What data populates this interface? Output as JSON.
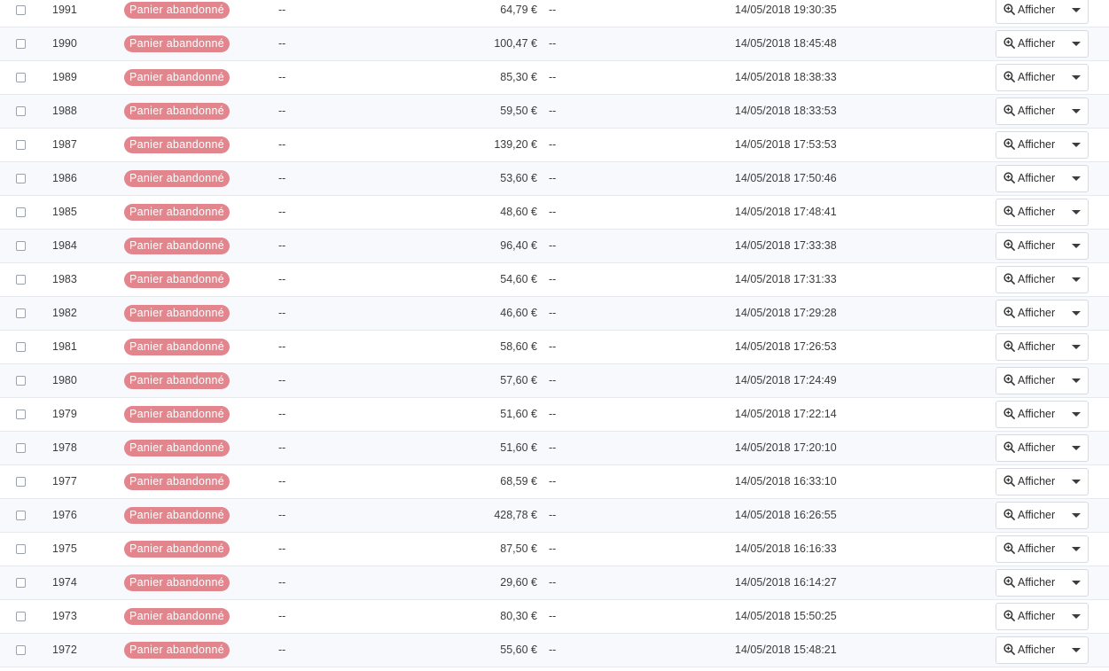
{
  "rows": [
    {
      "id": "1991",
      "status": "Panier abandonné",
      "customer": "--",
      "amount": "64,79 €",
      "payment": "--",
      "date": "14/05/2018 19:30:35",
      "view_label": "Afficher"
    },
    {
      "id": "1990",
      "status": "Panier abandonné",
      "customer": "--",
      "amount": "100,47 €",
      "payment": "--",
      "date": "14/05/2018 18:45:48",
      "view_label": "Afficher"
    },
    {
      "id": "1989",
      "status": "Panier abandonné",
      "customer": "--",
      "amount": "85,30 €",
      "payment": "--",
      "date": "14/05/2018 18:38:33",
      "view_label": "Afficher"
    },
    {
      "id": "1988",
      "status": "Panier abandonné",
      "customer": "--",
      "amount": "59,50 €",
      "payment": "--",
      "date": "14/05/2018 18:33:53",
      "view_label": "Afficher"
    },
    {
      "id": "1987",
      "status": "Panier abandonné",
      "customer": "--",
      "amount": "139,20 €",
      "payment": "--",
      "date": "14/05/2018 17:53:53",
      "view_label": "Afficher"
    },
    {
      "id": "1986",
      "status": "Panier abandonné",
      "customer": "--",
      "amount": "53,60 €",
      "payment": "--",
      "date": "14/05/2018 17:50:46",
      "view_label": "Afficher"
    },
    {
      "id": "1985",
      "status": "Panier abandonné",
      "customer": "--",
      "amount": "48,60 €",
      "payment": "--",
      "date": "14/05/2018 17:48:41",
      "view_label": "Afficher"
    },
    {
      "id": "1984",
      "status": "Panier abandonné",
      "customer": "--",
      "amount": "96,40 €",
      "payment": "--",
      "date": "14/05/2018 17:33:38",
      "view_label": "Afficher"
    },
    {
      "id": "1983",
      "status": "Panier abandonné",
      "customer": "--",
      "amount": "54,60 €",
      "payment": "--",
      "date": "14/05/2018 17:31:33",
      "view_label": "Afficher"
    },
    {
      "id": "1982",
      "status": "Panier abandonné",
      "customer": "--",
      "amount": "46,60 €",
      "payment": "--",
      "date": "14/05/2018 17:29:28",
      "view_label": "Afficher"
    },
    {
      "id": "1981",
      "status": "Panier abandonné",
      "customer": "--",
      "amount": "58,60 €",
      "payment": "--",
      "date": "14/05/2018 17:26:53",
      "view_label": "Afficher"
    },
    {
      "id": "1980",
      "status": "Panier abandonné",
      "customer": "--",
      "amount": "57,60 €",
      "payment": "--",
      "date": "14/05/2018 17:24:49",
      "view_label": "Afficher"
    },
    {
      "id": "1979",
      "status": "Panier abandonné",
      "customer": "--",
      "amount": "51,60 €",
      "payment": "--",
      "date": "14/05/2018 17:22:14",
      "view_label": "Afficher"
    },
    {
      "id": "1978",
      "status": "Panier abandonné",
      "customer": "--",
      "amount": "51,60 €",
      "payment": "--",
      "date": "14/05/2018 17:20:10",
      "view_label": "Afficher"
    },
    {
      "id": "1977",
      "status": "Panier abandonné",
      "customer": "--",
      "amount": "68,59 €",
      "payment": "--",
      "date": "14/05/2018 16:33:10",
      "view_label": "Afficher"
    },
    {
      "id": "1976",
      "status": "Panier abandonné",
      "customer": "--",
      "amount": "428,78 €",
      "payment": "--",
      "date": "14/05/2018 16:26:55",
      "view_label": "Afficher"
    },
    {
      "id": "1975",
      "status": "Panier abandonné",
      "customer": "--",
      "amount": "87,50 €",
      "payment": "--",
      "date": "14/05/2018 16:16:33",
      "view_label": "Afficher"
    },
    {
      "id": "1974",
      "status": "Panier abandonné",
      "customer": "--",
      "amount": "29,60 €",
      "payment": "--",
      "date": "14/05/2018 16:14:27",
      "view_label": "Afficher"
    },
    {
      "id": "1973",
      "status": "Panier abandonné",
      "customer": "--",
      "amount": "80,30 €",
      "payment": "--",
      "date": "14/05/2018 15:50:25",
      "view_label": "Afficher"
    },
    {
      "id": "1972",
      "status": "Panier abandonné",
      "customer": "--",
      "amount": "55,60 €",
      "payment": "--",
      "date": "14/05/2018 15:48:21",
      "view_label": "Afficher"
    }
  ],
  "colors": {
    "status_badge_bg": "#e2858d",
    "row_alt_bg": "#f7f9fc",
    "row_border": "#e6e9ee"
  },
  "icons": {
    "view": "zoom-in-icon",
    "dropdown": "caret-down-icon",
    "select": "checkbox"
  }
}
